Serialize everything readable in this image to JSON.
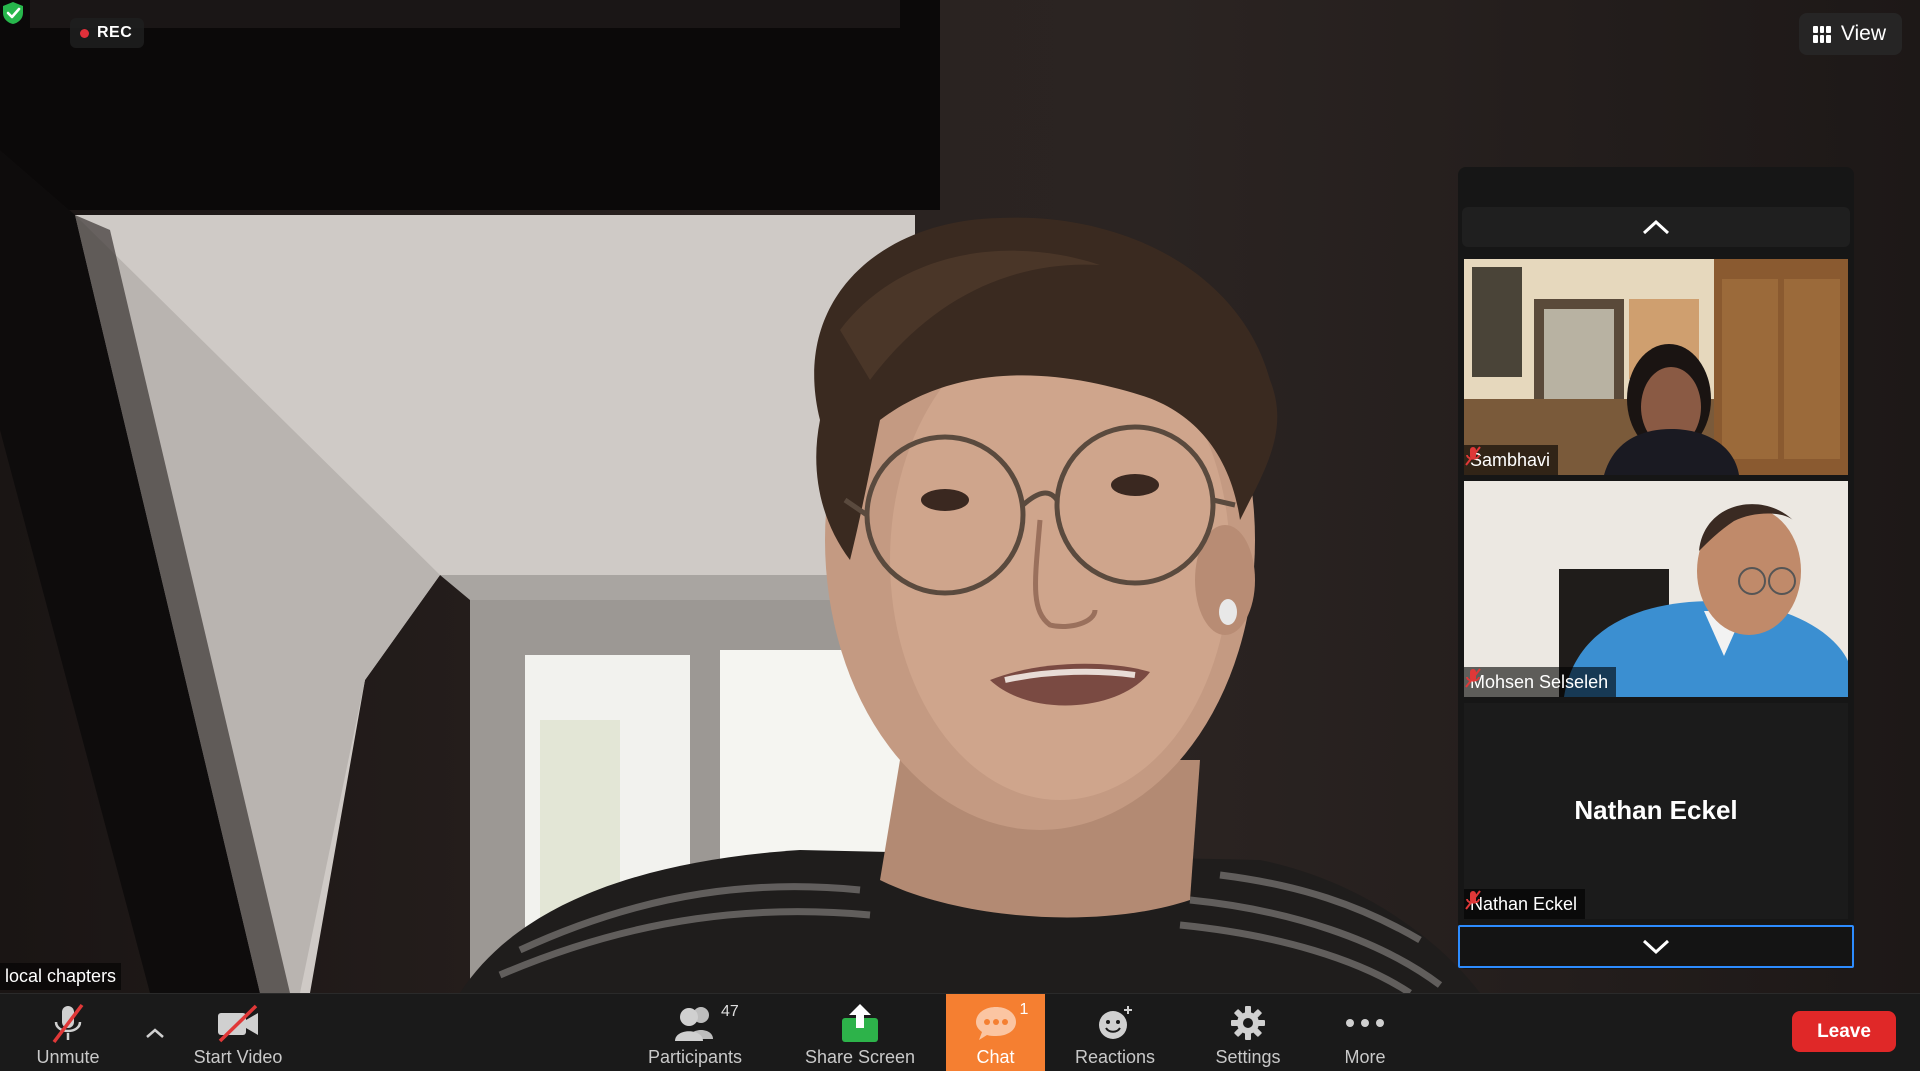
{
  "recording": {
    "label": "REC"
  },
  "header": {
    "view_label": "View"
  },
  "main_video": {
    "speaker_label": "local chapters"
  },
  "gallery": {
    "tiles": [
      {
        "name": "Sambhavi",
        "muted": true,
        "video": true
      },
      {
        "name": "Mohsen Selseleh",
        "muted": true,
        "video": true
      },
      {
        "name": "Nathan Eckel",
        "muted": true,
        "video": false,
        "display_name": "Nathan Eckel"
      }
    ]
  },
  "toolbar": {
    "unmute_label": "Unmute",
    "start_video_label": "Start Video",
    "participants_label": "Participants",
    "participants_count": "47",
    "share_screen_label": "Share Screen",
    "chat_label": "Chat",
    "chat_unread": "1",
    "reactions_label": "Reactions",
    "settings_label": "Settings",
    "more_label": "More",
    "leave_label": "Leave"
  },
  "colors": {
    "chat_active": "#f57f31",
    "leave": "#e02828",
    "secure_shield": "#27b74c",
    "share_screen": "#2db34a",
    "selection_border": "#2d8cff",
    "rec_dot": "#e0303a"
  }
}
